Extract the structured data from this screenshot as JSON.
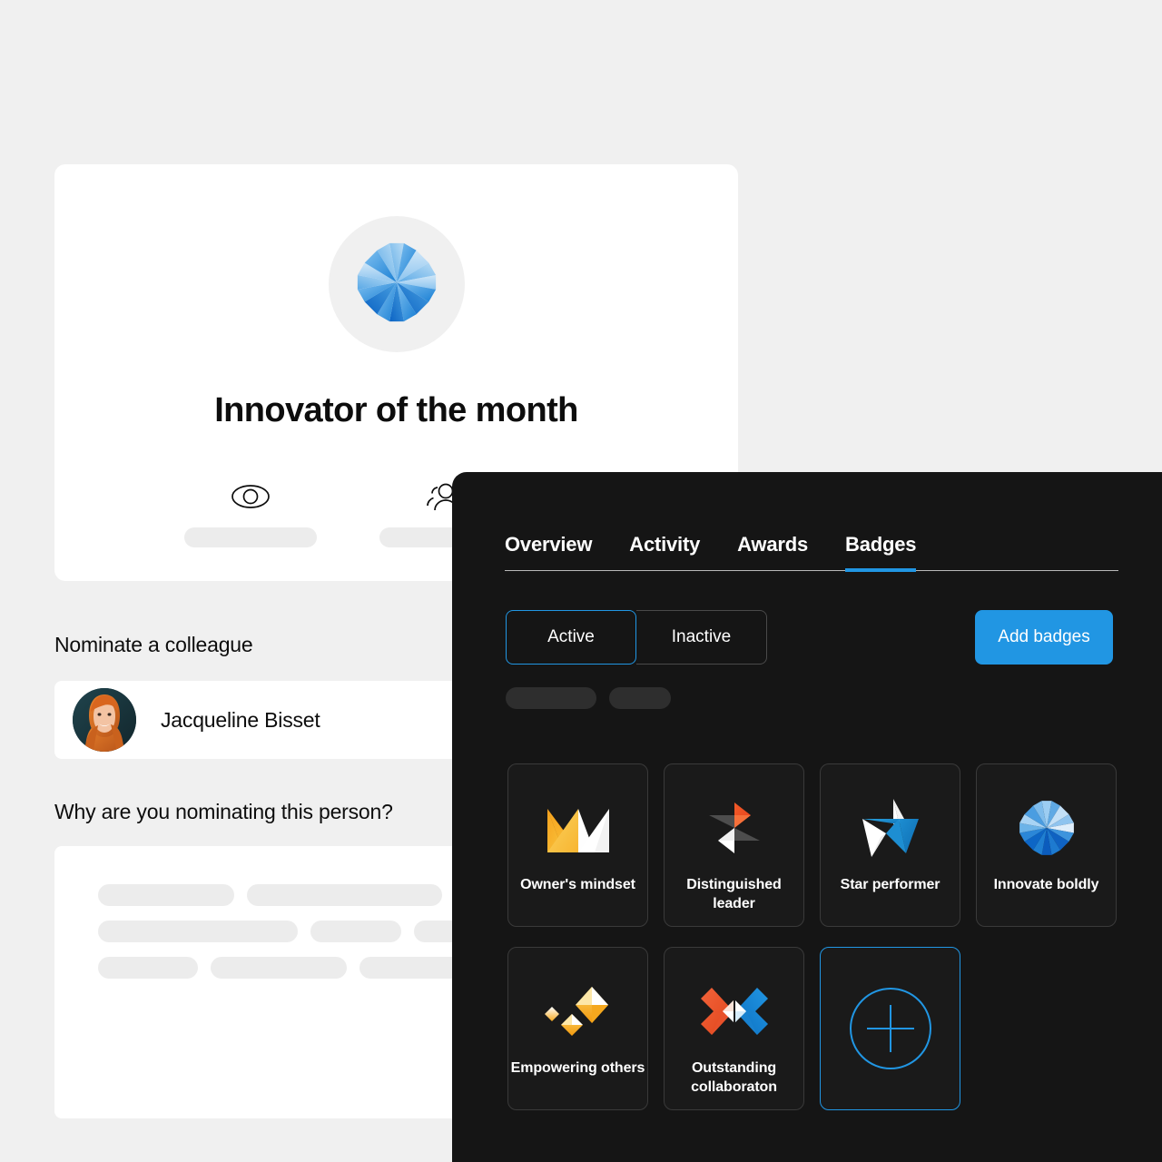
{
  "light_app": {
    "hero": {
      "badge_icon": "eight-point-star-icon",
      "title": "Innovator of the month",
      "stats": [
        {
          "icon": "eye-icon",
          "value_placeholder": ""
        },
        {
          "icon": "people-group-icon",
          "value_placeholder": ""
        },
        {
          "icon": "placeholder-icon",
          "value_placeholder": ""
        }
      ]
    },
    "nominate_label": "Nominate a colleague",
    "person": {
      "name": "Jacqueline Bisset",
      "avatar": "woman-portrait-avatar"
    },
    "why_label": "Why are you nominating this person?",
    "why_skeleton_rows": [
      [
        150,
        215
      ],
      [
        220,
        100,
        120
      ],
      [
        110,
        150,
        130
      ]
    ]
  },
  "dark_panel": {
    "tabs": [
      {
        "label": "Overview",
        "active": false
      },
      {
        "label": "Activity",
        "active": false
      },
      {
        "label": "Awards",
        "active": false
      },
      {
        "label": "Badges",
        "active": true
      }
    ],
    "filter": {
      "options": [
        {
          "label": "Active",
          "selected": true
        },
        {
          "label": "Inactive",
          "selected": false
        }
      ]
    },
    "add_badges_label": "Add badges",
    "chips": [
      100,
      68
    ],
    "badges": [
      {
        "label": "Owner's mindset",
        "icon": "crown-icon"
      },
      {
        "label": "Distinguished leader",
        "icon": "pinwheel-icon"
      },
      {
        "label": "Star performer",
        "icon": "five-point-star-icon"
      },
      {
        "label": "Innovate boldly",
        "icon": "eight-point-star-icon"
      },
      {
        "label": "Empowering others",
        "icon": "diamonds-icon"
      },
      {
        "label": "Outstanding collaboraton",
        "icon": "bowtie-arrows-icon"
      }
    ],
    "add_tile": {
      "icon": "circle-plus-icon"
    }
  },
  "colors": {
    "page_background": "#f0f0f0",
    "card_background": "#ffffff",
    "panel_background": "#151515",
    "accent_blue": "#2196e3",
    "skeleton_light": "#ececec",
    "skeleton_dark": "#2e2e2e",
    "text_dark": "#0d0d0d",
    "text_light": "#ffffff"
  }
}
